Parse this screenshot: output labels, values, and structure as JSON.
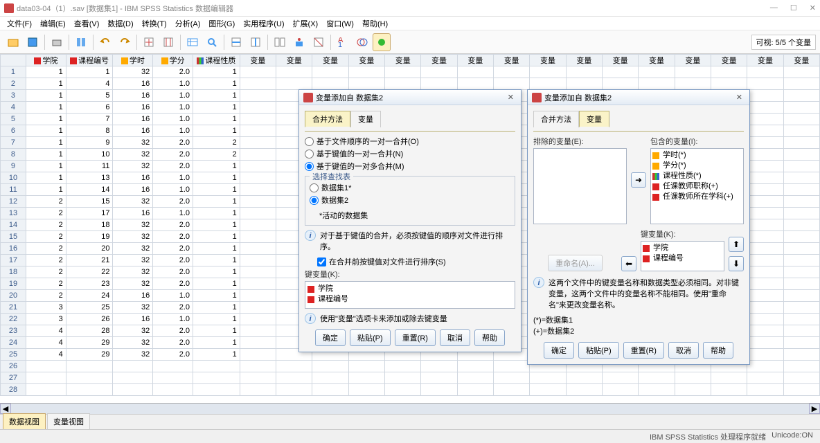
{
  "title": "data03-04（1）.sav [数据集1] - IBM SPSS Statistics 数据编辑器",
  "menu": [
    "文件(F)",
    "编辑(E)",
    "查看(V)",
    "数据(D)",
    "转换(T)",
    "分析(A)",
    "图形(G)",
    "实用程序(U)",
    "扩展(X)",
    "窗口(W)",
    "帮助(H)"
  ],
  "visibility": "可视: 5/5 个变量",
  "columns": [
    "学院",
    "课程编号",
    "学时",
    "学分",
    "课程性质"
  ],
  "empty_col": "变量",
  "rows": [
    [
      1,
      1,
      32,
      "2.0",
      1
    ],
    [
      1,
      4,
      16,
      "1.0",
      1
    ],
    [
      1,
      5,
      16,
      "1.0",
      1
    ],
    [
      1,
      6,
      16,
      "1.0",
      1
    ],
    [
      1,
      7,
      16,
      "1.0",
      1
    ],
    [
      1,
      8,
      16,
      "1.0",
      1
    ],
    [
      1,
      9,
      32,
      "2.0",
      2
    ],
    [
      1,
      10,
      32,
      "2.0",
      2
    ],
    [
      1,
      11,
      32,
      "2.0",
      1
    ],
    [
      1,
      13,
      16,
      "1.0",
      1
    ],
    [
      1,
      14,
      16,
      "1.0",
      1
    ],
    [
      2,
      15,
      32,
      "2.0",
      1
    ],
    [
      2,
      17,
      16,
      "1.0",
      1
    ],
    [
      2,
      18,
      32,
      "2.0",
      1
    ],
    [
      2,
      19,
      32,
      "2.0",
      1
    ],
    [
      2,
      20,
      32,
      "2.0",
      1
    ],
    [
      2,
      21,
      32,
      "2.0",
      1
    ],
    [
      2,
      22,
      32,
      "2.0",
      1
    ],
    [
      2,
      23,
      32,
      "2.0",
      1
    ],
    [
      2,
      24,
      16,
      "1.0",
      1
    ],
    [
      3,
      25,
      32,
      "2.0",
      1
    ],
    [
      3,
      26,
      16,
      "1.0",
      1
    ],
    [
      4,
      28,
      32,
      "2.0",
      1
    ],
    [
      4,
      29,
      32,
      "2.0",
      1
    ],
    [
      4,
      29,
      32,
      "2.0",
      1
    ]
  ],
  "tabs": {
    "data": "数据视图",
    "var": "变量视图"
  },
  "status": {
    "proc": "IBM SPSS Statistics 处理程序就绪",
    "unicode": "Unicode:ON"
  },
  "dialog1": {
    "title": "变量添加自 数据集2",
    "tab_merge": "合并方法",
    "tab_var": "变量",
    "r1": "基于文件顺序的一对一合并(O)",
    "r2": "基于键值的一对一合并(N)",
    "r3": "基于键值的一对多合并(M)",
    "lookup_legend": "选择查找表",
    "ds1": "数据集1*",
    "ds2": "数据集2",
    "active": "*活动的数据集",
    "note1": "对于基于键值的合并，必须按键值的顺序对文件进行排序。",
    "sort_ck": "在合并前按键值对文件进行排序(S)",
    "key_lbl": "键变量(K):",
    "k1": "学院",
    "k2": "课程编号",
    "note2": "使用\"变量\"选项卡来添加或除去键变量",
    "btn_ok": "确定",
    "btn_paste": "粘贴(P)",
    "btn_reset": "重置(R)",
    "btn_cancel": "取消",
    "btn_help": "帮助"
  },
  "dialog2": {
    "title": "变量添加自 数据集2",
    "tab_merge": "合并方法",
    "tab_var": "变量",
    "excl_lbl": "排除的变量(E):",
    "incl_lbl": "包含的变量(I):",
    "key_lbl": "键变量(K):",
    "rename": "重命名(A)...",
    "inc": [
      "学时(*)",
      "学分(*)",
      "课程性质(*)",
      "任课教师职称(+)",
      "任课教师所在学科(+)"
    ],
    "keys": [
      "学院",
      "课程编号"
    ],
    "note": "这两个文件中的键变量名称和数据类型必须相同。对非键变量，这两个文件中的变量名称不能相同。使用\"重命名\"来更改变量名称。",
    "leg1": "(*)=数据集1",
    "leg2": "(+)=数据集2",
    "btn_ok": "确定",
    "btn_paste": "粘贴(P)",
    "btn_reset": "重置(R)",
    "btn_cancel": "取消",
    "btn_help": "帮助"
  }
}
